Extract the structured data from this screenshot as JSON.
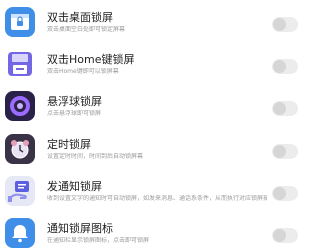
{
  "rows": [
    {
      "title": "双击桌面锁屏",
      "desc": "双击桌面空白处即可锁定屏幕",
      "icon": "lock-icon",
      "color": "#3f8ee7",
      "toggle": false
    },
    {
      "title": "双击Home键锁屏",
      "desc": "双击Home键即可以锁屏幕",
      "icon": "save-icon",
      "color": "#7467e6",
      "toggle": false
    },
    {
      "title": "悬浮球锁屏",
      "desc": "点击悬浮球即可锁屏",
      "icon": "floating-ball-icon",
      "color": "#2a2148",
      "toggle": false
    },
    {
      "title": "定时锁屏",
      "desc": "设置定时时间，时间到后自动锁屏幕",
      "icon": "alarm-clock-icon",
      "color": "#3a3348",
      "toggle": false
    },
    {
      "title": "发通知锁屏",
      "desc": "收到设置文字的通知时可自动锁屏，如发来消息、通话系条件，从而执行对应锁屏操作",
      "icon": "notification-hand-icon",
      "color": "#e6e8f5",
      "toggle": false
    },
    {
      "title": "通知锁屏图标",
      "desc": "在通知栏显示锁屏图标，点击即可锁屏",
      "icon": "bell-icon",
      "color": "#3f8ee7",
      "toggle": false
    }
  ]
}
